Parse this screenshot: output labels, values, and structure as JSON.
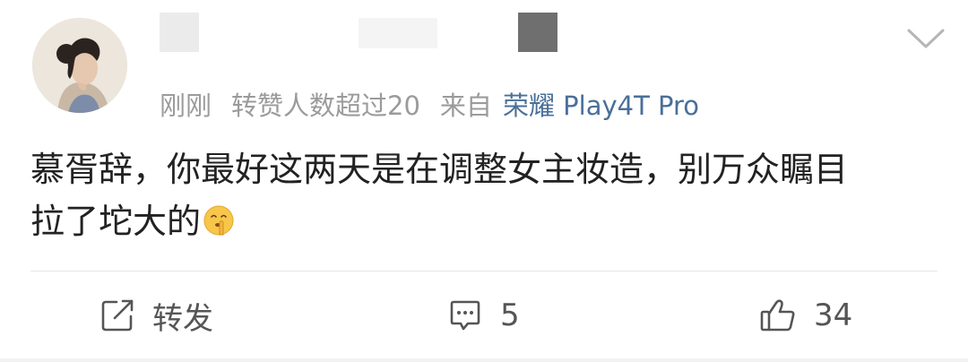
{
  "post": {
    "meta": {
      "time": "刚刚",
      "like_info": "转赞人数超过20",
      "source_prefix": "来自",
      "device": "荣耀 Play4T Pro"
    },
    "text_line1": "慕胥辞，你最好这两天是在调整女主妆造，别万众瞩目",
    "text_line2": "拉了坨大的",
    "emoji": "shushing-face-emoji"
  },
  "actions": {
    "repost_label": "转发",
    "comment_count": "5",
    "like_count": "34"
  },
  "icons": {
    "menu": "chevron-down-icon",
    "repost": "share-box-arrow-icon",
    "comment": "comment-bubble-icon",
    "like": "thumbs-up-icon"
  },
  "colors": {
    "text": "#222222",
    "meta": "#9b9b9b",
    "device_link": "#4a6f9a",
    "action_text": "#555555",
    "divider": "#e6e6e6"
  }
}
